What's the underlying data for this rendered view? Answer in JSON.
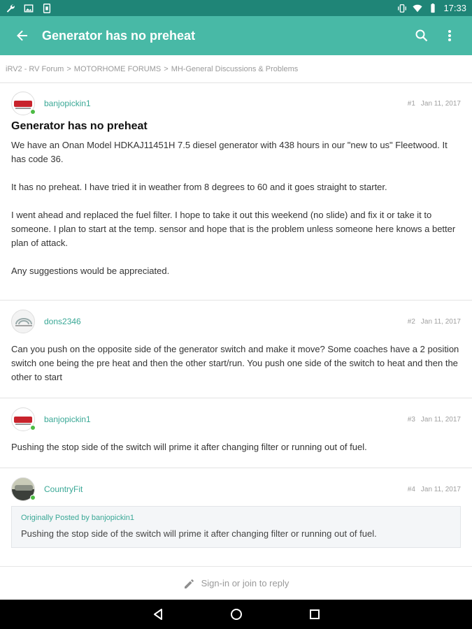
{
  "status_bar": {
    "time": "17:33",
    "left_icons": [
      "wrench-icon",
      "image-icon",
      "sim-icon"
    ],
    "right_icons": [
      "vibrate-icon",
      "wifi-icon",
      "battery-icon"
    ]
  },
  "app_bar": {
    "title": "Generator has no preheat",
    "back_icon": "arrow-back-icon",
    "search_icon": "search-icon",
    "menu_icon": "more-vert-icon"
  },
  "breadcrumb": {
    "items": [
      "iRV2 - RV Forum",
      "MOTORHOME FORUMS",
      "MH-General Discussions & Problems"
    ],
    "separator": ">"
  },
  "posts": [
    {
      "username": "banjopickin1",
      "number": "#1",
      "date": "Jan 11, 2017",
      "title": "Generator has no preheat",
      "paragraphs": [
        "We have an Onan Model HDKAJ11451H 7.5 diesel generator with 438 hours in our \"new to us\" Fleetwood. It has code 36.",
        "It has no preheat. I have tried it in weather from 8 degrees to 60 and it goes straight to starter.",
        "I went ahead and replaced the fuel filter. I hope to take it out this weekend (no slide) and fix it or take it to someone. I plan to start at the temp. sensor and hope that is the problem unless someone here knows a better plan of attack.",
        "Any suggestions would be appreciated."
      ]
    },
    {
      "username": "dons2346",
      "number": "#2",
      "date": "Jan 11, 2017",
      "paragraphs": [
        "Can you push on the opposite side of the generator switch and make it move? Some coaches have a 2 position switch one being the pre heat and then the other start/run. You push one side of the switch to heat and then the other to start"
      ]
    },
    {
      "username": "banjopickin1",
      "number": "#3",
      "date": "Jan 11, 2017",
      "paragraphs": [
        "Pushing the stop side of the switch will prime it after changing filter or running out of fuel."
      ]
    },
    {
      "username": "CountryFit",
      "number": "#4",
      "date": "Jan 11, 2017",
      "quote": {
        "header": "Originally Posted by banjopickin1",
        "body": "Pushing the stop side of the switch will prime it after changing filter or running out of fuel."
      }
    }
  ],
  "reply_bar": {
    "label": "Sign-in or join to reply",
    "icon": "pencil-icon"
  },
  "nav_bar": {
    "icons": [
      "nav-back-icon",
      "nav-home-icon",
      "nav-recents-icon"
    ]
  },
  "colors": {
    "status_bar": "#1f8577",
    "app_bar": "#48b9a6",
    "accent_text": "#3aa896",
    "online": "#4cbb44"
  }
}
